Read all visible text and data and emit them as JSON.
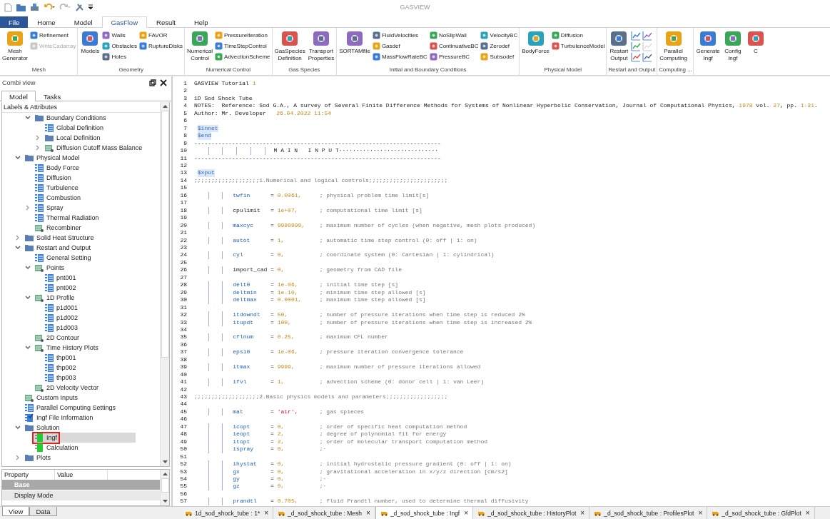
{
  "window": {
    "title": "GASVIEW"
  },
  "menu": [
    {
      "label": "File",
      "kind": "file",
      "selected": false
    },
    {
      "label": "Home",
      "kind": "tab",
      "selected": false
    },
    {
      "label": "Model",
      "kind": "tab",
      "selected": false
    },
    {
      "label": "GasFlow",
      "kind": "tab",
      "selected": true
    },
    {
      "label": "Result",
      "kind": "tab",
      "selected": false
    },
    {
      "label": "Help",
      "kind": "tab",
      "selected": false
    }
  ],
  "ribbon": {
    "groups": [
      {
        "label": "Mesh",
        "items": [
          {
            "kind": "large",
            "label": "Mesh\nGenerator",
            "disabled": false
          },
          {
            "kind": "small",
            "label": "Refinement",
            "disabled": false
          },
          {
            "kind": "small",
            "label": "WriteCadarray",
            "disabled": true
          }
        ]
      },
      {
        "label": "Geometry",
        "items": [
          {
            "kind": "large",
            "label": "Models",
            "disabled": false
          },
          {
            "kind": "small",
            "label": "Walls",
            "disabled": false
          },
          {
            "kind": "small",
            "label": "Obstacles",
            "disabled": false
          },
          {
            "kind": "small",
            "label": "Holes",
            "disabled": false
          },
          {
            "kind": "small",
            "label": "FAVOR",
            "disabled": false
          },
          {
            "kind": "small",
            "label": "RuptureDisks",
            "disabled": false
          }
        ]
      },
      {
        "label": "Numerical Control",
        "items": [
          {
            "kind": "large",
            "label": "Numerical\nControl",
            "disabled": false
          },
          {
            "kind": "small",
            "label": "PressureIteration",
            "disabled": false
          },
          {
            "kind": "small",
            "label": "TimeStepControl",
            "disabled": false
          },
          {
            "kind": "small",
            "label": "AdvectionScheme",
            "disabled": false
          }
        ]
      },
      {
        "label": "Gas Species",
        "items": [
          {
            "kind": "large",
            "label": "GasSpecies\nDefinition",
            "disabled": false
          },
          {
            "kind": "large",
            "label": "Transport\nProperties",
            "disabled": false
          }
        ]
      },
      {
        "label": "Initial and Boundary Conditions",
        "items": [
          {
            "kind": "large",
            "label": "SORTAMfile",
            "disabled": false
          },
          {
            "kind": "small",
            "label": "FluidVelocities",
            "disabled": false
          },
          {
            "kind": "small",
            "label": "Gasdef",
            "disabled": false
          },
          {
            "kind": "small",
            "label": "MassFlowRateBC",
            "disabled": false
          },
          {
            "kind": "small",
            "label": "NoSlipWall",
            "disabled": false
          },
          {
            "kind": "small",
            "label": "ContinuativeBC",
            "disabled": false
          },
          {
            "kind": "small",
            "label": "PressureBC",
            "disabled": false
          },
          {
            "kind": "small",
            "label": "VelocityBC",
            "disabled": false
          },
          {
            "kind": "small",
            "label": "Zerodef",
            "disabled": false
          },
          {
            "kind": "small",
            "label": "Subsodef",
            "disabled": false
          }
        ]
      },
      {
        "label": "Physical Model",
        "items": [
          {
            "kind": "large",
            "label": "BodyForce",
            "disabled": false
          },
          {
            "kind": "small",
            "label": "Diffusion",
            "disabled": false
          },
          {
            "kind": "small",
            "label": "TurbulenceModel",
            "disabled": false
          }
        ]
      },
      {
        "label": "Restart and Output",
        "items": [
          {
            "kind": "large",
            "label": "Restart\nOutput",
            "disabled": false
          },
          {
            "kind": "icon",
            "disabled": false
          },
          {
            "kind": "icon",
            "disabled": false
          },
          {
            "kind": "icon",
            "disabled": false
          },
          {
            "kind": "icon",
            "disabled": false
          },
          {
            "kind": "icon",
            "disabled": true
          },
          {
            "kind": "icon",
            "disabled": false
          }
        ]
      },
      {
        "label": "Computing ...",
        "items": [
          {
            "kind": "large",
            "label": "Parallel\nComputing",
            "disabled": false
          }
        ]
      },
      {
        "items": [
          {
            "kind": "large",
            "label": "Generate\nIngf",
            "disabled": false
          },
          {
            "kind": "large",
            "label": "Config\nIngf",
            "disabled": false
          },
          {
            "kind": "large",
            "label": "C",
            "disabled": false
          }
        ]
      }
    ]
  },
  "left_panel": {
    "title": "Combi view",
    "tabs": [
      {
        "label": "Model",
        "selected": true
      },
      {
        "label": "Tasks",
        "selected": false
      }
    ],
    "tree": {
      "header": "Labels & Attributes",
      "items": [
        {
          "children": [
            {
              "label": "Boundary Conditions",
              "kind": "folder",
              "expanded": true,
              "selected": false,
              "children": [
                {
                  "label": "Global Definition",
                  "kind": "list",
                  "selected": false
                },
                {
                  "label": "Local Definition",
                  "kind": "folder",
                  "expanded": false,
                  "selected": false
                },
                {
                  "label": "Diffusion Cutoff Mass Balance",
                  "kind": "table",
                  "expanded": false,
                  "selected": false
                }
              ]
            }
          ]
        },
        {
          "label": "Physical Model",
          "kind": "folder",
          "expanded": true,
          "selected": false,
          "children": [
            {
              "label": "Body Force",
              "kind": "list",
              "selected": false
            },
            {
              "label": "Diffusion",
              "kind": "list",
              "selected": false
            },
            {
              "label": "Turbulence",
              "kind": "list",
              "selected": false
            },
            {
              "label": "Combustion",
              "kind": "list",
              "selected": false
            },
            {
              "label": "Spray",
              "kind": "list",
              "expanded": false,
              "selected": false
            },
            {
              "label": "Thermal Radiation",
              "kind": "list",
              "selected": false
            },
            {
              "label": "Recombiner",
              "kind": "table",
              "selected": false
            }
          ]
        },
        {
          "label": "Solid Heat Structure",
          "kind": "folder",
          "expanded": false,
          "selected": false
        },
        {
          "label": "Restart and Output",
          "kind": "folder",
          "expanded": true,
          "selected": false,
          "children": [
            {
              "label": "General Setting",
              "kind": "list",
              "selected": false
            },
            {
              "label": "Points",
              "kind": "table",
              "expanded": true,
              "selected": false,
              "children": [
                {
                  "label": "pnt001",
                  "kind": "list",
                  "selected": false
                },
                {
                  "label": "pnt002",
                  "kind": "list",
                  "selected": false
                }
              ]
            },
            {
              "label": "1D Profile",
              "kind": "table",
              "expanded": true,
              "selected": false,
              "children": [
                {
                  "label": "p1d001",
                  "kind": "list",
                  "selected": false
                },
                {
                  "label": "p1d002",
                  "kind": "list",
                  "selected": false
                },
                {
                  "label": "p1d003",
                  "kind": "list",
                  "selected": false
                }
              ]
            },
            {
              "label": "2D Contour",
              "kind": "table",
              "selected": false
            },
            {
              "label": "Time History Plots",
              "kind": "table",
              "expanded": true,
              "selected": false,
              "children": [
                {
                  "label": "thp001",
                  "kind": "list",
                  "selected": false
                },
                {
                  "label": "thp002",
                  "kind": "list",
                  "selected": false
                },
                {
                  "label": "thp003",
                  "kind": "list",
                  "selected": false
                }
              ]
            },
            {
              "label": "2D Velocity Vector",
              "kind": "table",
              "selected": false
            }
          ]
        },
        {
          "label": "Custom Inputs",
          "kind": "table",
          "selected": false
        },
        {
          "label": "Parallel Computing Settings",
          "kind": "list",
          "selected": false
        },
        {
          "label": "Ingf File Information",
          "kind": "checklist",
          "selected": false
        },
        {
          "label": "Solution",
          "kind": "folder",
          "expanded": true,
          "selected": false,
          "children": [
            {
              "label": "Ingf",
              "kind": "block",
              "selected": true
            },
            {
              "label": "Calculation",
              "kind": "block",
              "selected": false
            }
          ]
        },
        {
          "label": "Plots",
          "kind": "folder",
          "expanded": false,
          "selected": false
        }
      ]
    },
    "properties": {
      "columns": [
        "Property",
        "Value"
      ],
      "rows": [
        {
          "label": "Base",
          "kind": "category"
        },
        {
          "label": "Display Mode",
          "kind": "item"
        }
      ]
    },
    "bottom_tabs": [
      {
        "label": "View",
        "selected": true
      },
      {
        "label": "Data",
        "selected": false
      }
    ]
  },
  "editor": {
    "lines": [
      {
        "n": "1",
        "kind": "text",
        "segs": [
          {
            "t": "GASVIEW Tutorial ",
            "kind": "plain"
          },
          {
            "t": "1",
            "kind": "number"
          }
        ]
      },
      {
        "n": "2",
        "kind": "blank"
      },
      {
        "n": "3",
        "kind": "text",
        "segs": [
          {
            "t": "1D Sod Shock Tube",
            "kind": "plain"
          }
        ]
      },
      {
        "n": "4",
        "kind": "text",
        "segs": [
          {
            "t": "NOTES:  Reference: Sod G.A., A survey of Several Finite Difference Methods for Systems of Nonlinear Hyperbolic Conservation, Journal of Computational Physics, ",
            "kind": "plain"
          },
          {
            "t": "1978",
            "kind": "number"
          },
          {
            "t": " vol. ",
            "kind": "plain"
          },
          {
            "t": "27",
            "kind": "number"
          },
          {
            "t": ", pp. ",
            "kind": "plain"
          },
          {
            "t": "1-31",
            "kind": "number"
          },
          {
            "t": ".",
            "kind": "plain"
          }
        ]
      },
      {
        "n": "5",
        "kind": "text",
        "segs": [
          {
            "t": "Author: Mr. Developer   ",
            "kind": "plain"
          },
          {
            "t": "26.04.2022 11:54",
            "kind": "number"
          }
        ]
      },
      {
        "n": "6",
        "kind": "blank"
      },
      {
        "n": "7",
        "kind": "tag",
        "text": "$innet"
      },
      {
        "n": "8",
        "kind": "tag",
        "text": "$end"
      },
      {
        "n": "9",
        "kind": "rule",
        "text": "------------------------------------------------------------------------"
      },
      {
        "n": "10",
        "kind": "banner",
        "text": "M A I N   I N P U T·····························"
      },
      {
        "n": "11",
        "kind": "rule",
        "text": "------------------------------------------------------------------------"
      },
      {
        "n": "12",
        "kind": "blank"
      },
      {
        "n": "13",
        "kind": "tag",
        "text": "$xput"
      },
      {
        "n": "14",
        "kind": "section",
        "text": ";;;;;;;;;;;;;;;;;;;1.Numerical and logical controls;;;;;;;;;;;;;;;;;;;;;;;"
      },
      {
        "n": "15",
        "kind": "blank"
      },
      {
        "n": "16",
        "kind": "param",
        "segs": [
          {
            "t": "twfin",
            "kind": "keyword"
          },
          {
            "t": "=",
            "kind": "plain"
          },
          {
            "t": "0.0061,",
            "kind": "number"
          },
          {
            "t": "; physical problem time limit[s]",
            "kind": "comment"
          }
        ]
      },
      {
        "n": "17",
        "kind": "blank"
      },
      {
        "n": "18",
        "kind": "param",
        "segs": [
          {
            "t": "cpulimit",
            "kind": "plain"
          },
          {
            "t": "=",
            "kind": "plain"
          },
          {
            "t": "1e+07,",
            "kind": "number"
          },
          {
            "t": "; computational time limit [s]",
            "kind": "comment"
          }
        ]
      },
      {
        "n": "19",
        "kind": "blank"
      },
      {
        "n": "20",
        "kind": "param",
        "segs": [
          {
            "t": "maxcyc",
            "kind": "keyword"
          },
          {
            "t": "=",
            "kind": "plain"
          },
          {
            "t": "9999999,",
            "kind": "number"
          },
          {
            "t": "; maximum number of cycles (when negative, mesh plots produced)",
            "kind": "comment"
          }
        ]
      },
      {
        "n": "21",
        "kind": "blank"
      },
      {
        "n": "22",
        "kind": "param",
        "segs": [
          {
            "t": "autot",
            "kind": "keyword"
          },
          {
            "t": "=",
            "kind": "plain"
          },
          {
            "t": "1,",
            "kind": "number"
          },
          {
            "t": "; automatic time step control (0: off | 1: on)",
            "kind": "comment"
          }
        ]
      },
      {
        "n": "23",
        "kind": "blank"
      },
      {
        "n": "24",
        "kind": "param",
        "segs": [
          {
            "t": "cyl",
            "kind": "keyword"
          },
          {
            "t": "=",
            "kind": "plain"
          },
          {
            "t": "0,",
            "kind": "number"
          },
          {
            "t": "; coordinate system (0: Cartesian | 1: cylindrical)",
            "kind": "comment"
          }
        ]
      },
      {
        "n": "25",
        "kind": "blank"
      },
      {
        "n": "26",
        "kind": "param",
        "segs": [
          {
            "t": "import_cad",
            "kind": "plain"
          },
          {
            "t": "=",
            "kind": "plain"
          },
          {
            "t": "0,",
            "kind": "number"
          },
          {
            "t": "; geometry from CAD file",
            "kind": "comment"
          }
        ]
      },
      {
        "n": "27",
        "kind": "blank"
      },
      {
        "n": "28",
        "kind": "param",
        "segs": [
          {
            "t": "delt0",
            "kind": "keyword"
          },
          {
            "t": "=",
            "kind": "plain"
          },
          {
            "t": "1e-06,",
            "kind": "number"
          },
          {
            "t": "; initial time step [s]",
            "kind": "comment"
          }
        ]
      },
      {
        "n": "29",
        "kind": "param",
        "segs": [
          {
            "t": "deltmin",
            "kind": "keyword"
          },
          {
            "t": "=",
            "kind": "plain"
          },
          {
            "t": "1e-10,",
            "kind": "number"
          },
          {
            "t": "; minimum time step allowed [s]",
            "kind": "comment"
          }
        ]
      },
      {
        "n": "30",
        "kind": "param",
        "segs": [
          {
            "t": "deltmax",
            "kind": "keyword"
          },
          {
            "t": "=",
            "kind": "plain"
          },
          {
            "t": "0.0001,",
            "kind": "number"
          },
          {
            "t": "; maximum time step allowed [s]",
            "kind": "comment"
          }
        ]
      },
      {
        "n": "31",
        "kind": "blank"
      },
      {
        "n": "32",
        "kind": "param",
        "segs": [
          {
            "t": "itdowndt",
            "kind": "keyword"
          },
          {
            "t": "=",
            "kind": "plain"
          },
          {
            "t": "50,",
            "kind": "number"
          },
          {
            "t": "; number of pressure iterations when time step is reduced 2%",
            "kind": "comment"
          }
        ]
      },
      {
        "n": "33",
        "kind": "param",
        "segs": [
          {
            "t": "itupdt",
            "kind": "keyword"
          },
          {
            "t": "=",
            "kind": "plain"
          },
          {
            "t": "100,",
            "kind": "number"
          },
          {
            "t": "; number of pressure iterations when time step is increased 2%",
            "kind": "comment"
          }
        ]
      },
      {
        "n": "34",
        "kind": "blank"
      },
      {
        "n": "35",
        "kind": "param",
        "segs": [
          {
            "t": "cflnum",
            "kind": "keyword"
          },
          {
            "t": "=",
            "kind": "plain"
          },
          {
            "t": "0.25,",
            "kind": "number"
          },
          {
            "t": "; maximum CFL number",
            "kind": "comment"
          }
        ]
      },
      {
        "n": "36",
        "kind": "blank"
      },
      {
        "n": "37",
        "kind": "param",
        "segs": [
          {
            "t": "epsi0",
            "kind": "keyword"
          },
          {
            "t": "=",
            "kind": "plain"
          },
          {
            "t": "1e-06,",
            "kind": "number"
          },
          {
            "t": "; pressure iteration convergence tolerance",
            "kind": "comment"
          }
        ]
      },
      {
        "n": "38",
        "kind": "blank"
      },
      {
        "n": "39",
        "kind": "param",
        "segs": [
          {
            "t": "itmax",
            "kind": "keyword"
          },
          {
            "t": "=",
            "kind": "plain"
          },
          {
            "t": "9999,",
            "kind": "number"
          },
          {
            "t": "; maximum number of pressure iterations allowed",
            "kind": "comment"
          }
        ]
      },
      {
        "n": "40",
        "kind": "blank"
      },
      {
        "n": "41",
        "kind": "param",
        "segs": [
          {
            "t": "ifvl",
            "kind": "keyword"
          },
          {
            "t": "=",
            "kind": "plain"
          },
          {
            "t": "1,",
            "kind": "number"
          },
          {
            "t": "; advection scheme (0: donor cell | 1: van Leer)",
            "kind": "comment"
          }
        ]
      },
      {
        "n": "42",
        "kind": "blank"
      },
      {
        "n": "43",
        "kind": "section",
        "text": ";;;;;;;;;;;;;;;;;;;2.Basic physics models and parameters;;;;;;;;;;;;;;;;;;"
      },
      {
        "n": "44",
        "kind": "blank"
      },
      {
        "n": "45",
        "kind": "param",
        "segs": [
          {
            "t": "mat",
            "kind": "keyword"
          },
          {
            "t": "=",
            "kind": "plain"
          },
          {
            "t": "'air',",
            "kind": "string"
          },
          {
            "t": "; gas spieces",
            "kind": "comment"
          }
        ]
      },
      {
        "n": "46",
        "kind": "blank"
      },
      {
        "n": "47",
        "kind": "param",
        "segs": [
          {
            "t": "icopt",
            "kind": "keyword"
          },
          {
            "t": "=",
            "kind": "plain"
          },
          {
            "t": "0,",
            "kind": "number"
          },
          {
            "t": "; order of specific heat computation method",
            "kind": "comment"
          }
        ]
      },
      {
        "n": "48",
        "kind": "param",
        "segs": [
          {
            "t": "ieopt",
            "kind": "keyword"
          },
          {
            "t": "=",
            "kind": "plain"
          },
          {
            "t": "2,",
            "kind": "number"
          },
          {
            "t": "; degree of polynomial fit for energy",
            "kind": "comment"
          }
        ]
      },
      {
        "n": "49",
        "kind": "param",
        "segs": [
          {
            "t": "itopt",
            "kind": "keyword"
          },
          {
            "t": "=",
            "kind": "plain"
          },
          {
            "t": "2,",
            "kind": "number"
          },
          {
            "t": "; order of molecular transport computation method",
            "kind": "comment"
          }
        ]
      },
      {
        "n": "50",
        "kind": "param",
        "segs": [
          {
            "t": "ispray",
            "kind": "keyword"
          },
          {
            "t": "=",
            "kind": "plain"
          },
          {
            "t": "0,",
            "kind": "number"
          },
          {
            "t": ";·",
            "kind": "comment"
          }
        ]
      },
      {
        "n": "51",
        "kind": "blank"
      },
      {
        "n": "52",
        "kind": "param",
        "segs": [
          {
            "t": "ihystat",
            "kind": "keyword"
          },
          {
            "t": "=",
            "kind": "plain"
          },
          {
            "t": "0,",
            "kind": "number"
          },
          {
            "t": "; initial hydrostatic pressure gradient (0: off | 1: on)",
            "kind": "comment"
          }
        ]
      },
      {
        "n": "53",
        "kind": "param",
        "segs": [
          {
            "t": "gx",
            "kind": "keyword"
          },
          {
            "t": "=",
            "kind": "plain"
          },
          {
            "t": "0,",
            "kind": "number"
          },
          {
            "t": "; gravitational acceleration in x/y/z direction [cm/s2]",
            "kind": "comment"
          }
        ]
      },
      {
        "n": "54",
        "kind": "param",
        "segs": [
          {
            "t": "gy",
            "kind": "keyword"
          },
          {
            "t": "=",
            "kind": "plain"
          },
          {
            "t": "0,",
            "kind": "number"
          },
          {
            "t": ";·",
            "kind": "comment"
          }
        ]
      },
      {
        "n": "55",
        "kind": "param",
        "segs": [
          {
            "t": "gz",
            "kind": "keyword"
          },
          {
            "t": "=",
            "kind": "plain"
          },
          {
            "t": "0,",
            "kind": "number"
          },
          {
            "t": ";·",
            "kind": "comment"
          }
        ]
      },
      {
        "n": "56",
        "kind": "blank"
      },
      {
        "n": "57",
        "kind": "param",
        "segs": [
          {
            "t": "prandtl",
            "kind": "keyword"
          },
          {
            "t": "=",
            "kind": "plain"
          },
          {
            "t": "0.705,",
            "kind": "number"
          },
          {
            "t": "; fluid Prandtl number, used to determine thermal diffusivity",
            "kind": "comment"
          }
        ]
      }
    ]
  },
  "document_tabs": [
    {
      "label": "1d_sod_shock_tube : 1*",
      "selected": false,
      "close": "×"
    },
    {
      "label": "_d_sod_shock_tube : Mesh",
      "selected": false,
      "close": "×"
    },
    {
      "label": "_d_sod_shock_tube : Ingf",
      "selected": true,
      "close": "×"
    },
    {
      "label": "_d_sod_shock_tube : HistoryPlot",
      "selected": false,
      "close": "×"
    },
    {
      "label": "_d_sod_shock_tube : ProfilesPlot",
      "selected": false,
      "close": "×"
    },
    {
      "label": "_d_sod_shock_tube : GfdPlot",
      "selected": false,
      "close": "×"
    }
  ]
}
